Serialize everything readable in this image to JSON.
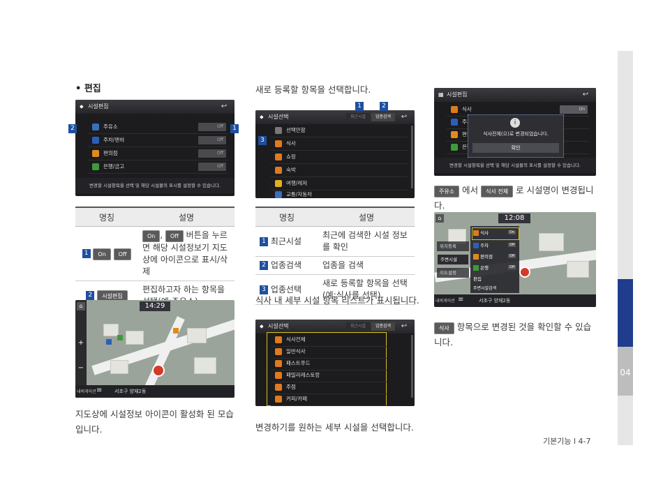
{
  "section": {
    "bullet": "•",
    "title": "편집"
  },
  "screen1": {
    "title": "시설편집",
    "rows": [
      "주유소",
      "주차/맨허",
      "편의점",
      "은행/금고"
    ],
    "off": "Off",
    "footer": "변경할 시설항목을 선택 및 해당 시설물의 표시를 설정할 수 있습니다.",
    "marker_left": "2",
    "marker_right": "1"
  },
  "table1": {
    "head": [
      "명칭",
      "설명"
    ],
    "rows": [
      {
        "num": "1",
        "name_buttons": [
          "On",
          "Off"
        ],
        "desc_buttons": [
          "On",
          "Off"
        ],
        "desc_sep": ",",
        "desc": "버튼을 누르면 해당 시설정보기 지도상에 아이콘으로 표시/삭제"
      },
      {
        "num": "2",
        "name_button": "시설편집",
        "desc": "편집하고자 하는 항목을 선택(예:주유소)"
      }
    ]
  },
  "map1": {
    "clock": "14:29",
    "location": "서초구 양재2동",
    "mode": "내비게이션"
  },
  "caption_left": "지도상에 시설정보 아이콘이 활성화 된 모습입니다.",
  "middle_intro": "새로 등록할 항목을 선택합니다.",
  "screen2": {
    "title": "시설선택",
    "tabs": [
      "최근시설",
      "업종검색"
    ],
    "rows": [
      "선택안함",
      "식사",
      "쇼핑",
      "숙박",
      "여행/레저",
      "교통/자동차"
    ],
    "markers": [
      "1",
      "2",
      "3"
    ]
  },
  "table2": {
    "head": [
      "명칭",
      "설명"
    ],
    "rows": [
      {
        "num": "1",
        "name": "최근시설",
        "desc": "최근에 검색한 시설 정보를 확인"
      },
      {
        "num": "2",
        "name": "업종검색",
        "desc": "업종을 검색"
      },
      {
        "num": "3",
        "name": "업종선택",
        "desc": "새로 등록할 항목을 선택 (예:식사를 선택)"
      }
    ]
  },
  "middle_caption2": "식사 내 세부 시설 항목 리스트가 표시됩니다.",
  "screen3": {
    "title": "시설선택",
    "tabs": [
      "최근시설",
      "업종검색"
    ],
    "rows": [
      "식사전체",
      "일반식사",
      "패스트푸드",
      "패밀리레스토랑",
      "주점",
      "커피/카페"
    ]
  },
  "middle_caption3": "변경하기를 원하는 세부 시설을 선택합니다.",
  "screen4": {
    "title": "시설편집",
    "rows": [
      "식사",
      "주차",
      "편의",
      "은행"
    ],
    "on": "On",
    "dialog": "식사전체(으)로 변경되었습니다.",
    "dialog_btn": "확인",
    "footer": "변경할 시설항목을 선택 및 해당 시설물의 표시를 설정할 수 있습니다."
  },
  "right_text1": {
    "btn1": "주유소",
    "mid": "에서",
    "btn2": "식사 전체",
    "end": "로 시설명이 변경됩니다."
  },
  "map2": {
    "clock": "12:08",
    "menu": [
      "위치등록",
      "주변시설",
      "지도설정"
    ],
    "list": [
      "식사",
      "주차",
      "편의점",
      "은행",
      "편집"
    ],
    "list_on": "On",
    "list_off": "Off",
    "bottom_btn": "주변시설검색",
    "location": "서초구 양재2동",
    "mode": "내비게이션"
  },
  "right_text2": {
    "btn": "식사",
    "text": "항목으로 변경된 것을 확인할 수 있습니다."
  },
  "side_tab": "04",
  "footer": "기본기능 l 4-7",
  "colors": {
    "accent_blue": "#1f3d8c",
    "marker_blue": "#1f4f9e"
  }
}
